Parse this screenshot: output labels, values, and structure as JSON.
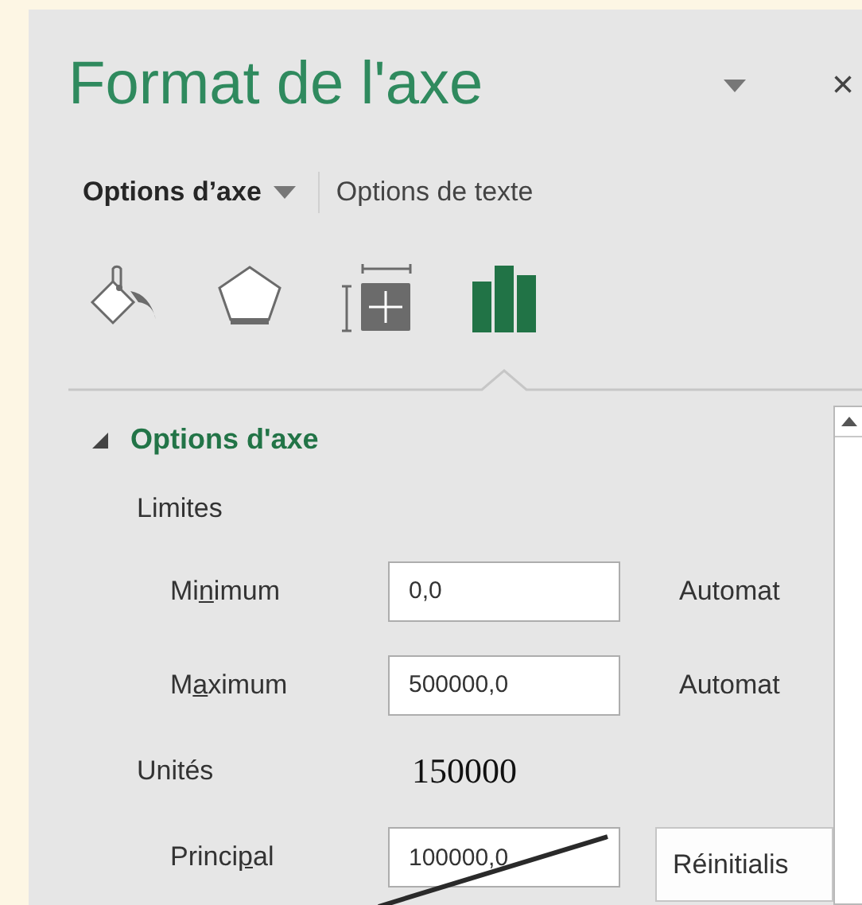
{
  "panel": {
    "title": "Format de l'axe",
    "close": "×",
    "tabs": [
      {
        "label": "Options d’axe",
        "selected": true,
        "dropdown": true
      },
      {
        "label": "Options de texte",
        "selected": false,
        "dropdown": false
      }
    ],
    "icon_tabs": [
      {
        "kind": "fill",
        "selected": false
      },
      {
        "kind": "effects",
        "selected": false
      },
      {
        "kind": "size",
        "selected": false
      },
      {
        "kind": "axis",
        "selected": true
      }
    ],
    "section": {
      "title": "Options d'axe",
      "expanded": true,
      "groups": [
        {
          "heading": "Limites",
          "rows": [
            {
              "label_parts": [
                "Mi",
                "n",
                "imum"
              ],
              "value": "0,0",
              "struck": false,
              "action": "Automat",
              "kind": "text"
            },
            {
              "label_parts": [
                "M",
                "a",
                "ximum"
              ],
              "value": "500000,0",
              "struck": false,
              "action": "Automat",
              "kind": "text"
            }
          ]
        },
        {
          "heading": "Unités",
          "note": "150000",
          "rows": [
            {
              "label_parts": [
                "Princi",
                "p",
                "al"
              ],
              "value": "100000,0",
              "struck": true,
              "action": "Réinitialis",
              "kind": "button"
            }
          ]
        }
      ]
    }
  }
}
